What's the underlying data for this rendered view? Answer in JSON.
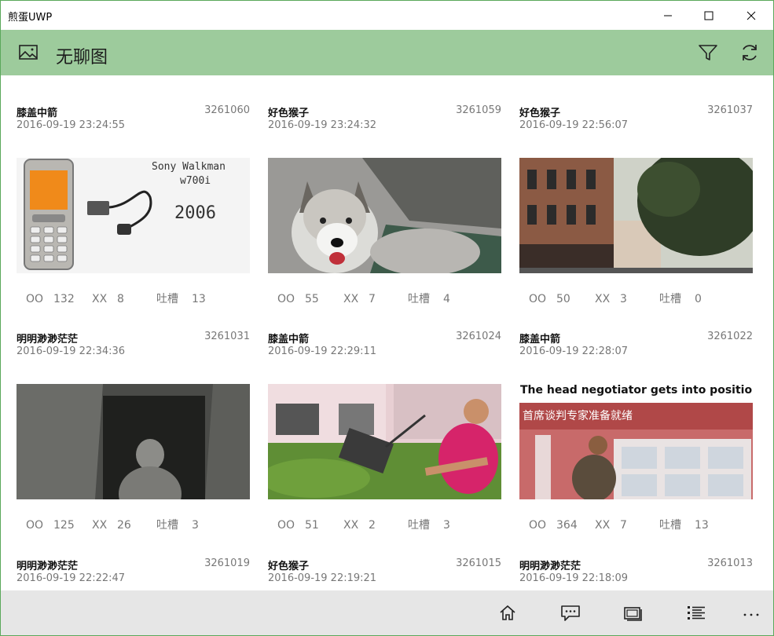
{
  "window": {
    "title": "煎蛋UWP"
  },
  "header": {
    "title": "无聊图"
  },
  "stats_labels": {
    "oo": "OO",
    "xx": "XX",
    "comments": "吐槽"
  },
  "posts": [
    {
      "author": "膝盖中箭",
      "id": "3261060",
      "time": "2016-09-19 23:24:55",
      "oo": "132",
      "xx": "8",
      "comments": "13",
      "image": {
        "subject": "sony-walkman-phone",
        "text_line1": "Sony Walkman",
        "text_line2": "w700i",
        "text_year": "2006"
      }
    },
    {
      "author": "好色猴子",
      "id": "3261059",
      "time": "2016-09-19 23:24:32",
      "oo": "55",
      "xx": "7",
      "comments": "4",
      "image": {
        "subject": "husky-dog"
      }
    },
    {
      "author": "好色猴子",
      "id": "3261037",
      "time": "2016-09-19 22:56:07",
      "oo": "50",
      "xx": "3",
      "comments": "0",
      "image": {
        "subject": "street-buildings"
      }
    },
    {
      "author": "明明渺渺茫茫",
      "id": "3261031",
      "time": "2016-09-19 22:34:36",
      "oo": "125",
      "xx": "26",
      "comments": "3",
      "image": {
        "subject": "dark-doorway-figure"
      }
    },
    {
      "author": "膝盖中箭",
      "id": "3261024",
      "time": "2016-09-19 22:29:11",
      "oo": "51",
      "xx": "2",
      "comments": "3",
      "image": {
        "subject": "man-with-lawnmower"
      }
    },
    {
      "author": "膝盖中箭",
      "id": "3261022",
      "time": "2016-09-19 22:28:07",
      "oo": "364",
      "xx": "7",
      "comments": "13",
      "image": {
        "subject": "man-in-window",
        "caption_en": "The head negotiator gets into position",
        "caption_cn": "首席谈判专家准备就绪"
      }
    },
    {
      "author": "明明渺渺茫茫",
      "id": "3261019",
      "time": "2016-09-19 22:22:47"
    },
    {
      "author": "好色猴子",
      "id": "3261015",
      "time": "2016-09-19 22:19:21"
    },
    {
      "author": "明明渺渺茫茫",
      "id": "3261013",
      "time": "2016-09-19 22:18:09"
    }
  ],
  "icons": {
    "header_left": "image-icon",
    "header_right": [
      "filter-icon",
      "refresh-icon"
    ],
    "bottom_bar": [
      "home-icon",
      "comment-icon",
      "slideshow-icon",
      "list-icon",
      "more-icon"
    ]
  },
  "colors": {
    "accent": "#9dcb9c",
    "window_border": "#5aa85a",
    "bottom_bar": "#e6e6e6",
    "meta_text": "#777777"
  }
}
